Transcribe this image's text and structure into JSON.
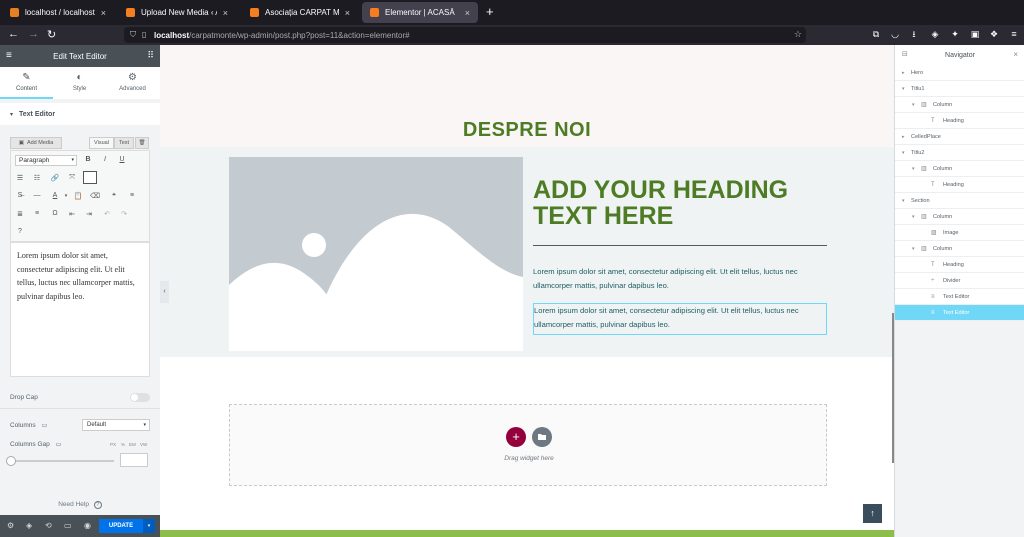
{
  "browser": {
    "tabs": [
      {
        "title": "localhost / localhost | phpMy",
        "color": "#e67e22"
      },
      {
        "title": "Upload New Media ‹ Asociați",
        "color": "#f57f20"
      },
      {
        "title": "Asociația CARPAT MONTE –",
        "color": "#f57f20"
      },
      {
        "title": "Elementor | ACASĂ",
        "color": "#f57f20"
      }
    ],
    "url_host": "localhost",
    "url_path": "/carpatmonte/wp-admin/post.php?post=11&action=elementor#"
  },
  "left_panel": {
    "title": "Edit Text Editor",
    "tabs": [
      {
        "label": "Content",
        "icon": "pencil-icon",
        "glyph": "✎"
      },
      {
        "label": "Style",
        "icon": "half-circle-icon",
        "glyph": "◐"
      },
      {
        "label": "Advanced",
        "icon": "gear-icon",
        "glyph": "⚙"
      }
    ],
    "section": "Text Editor",
    "add_media": "Add Media",
    "visual": "Visual",
    "text": "Text",
    "paragraph_select": "Paragraph",
    "content": "Lorem ipsum dolor sit amet, consectetur adipiscing elit. Ut elit tellus, luctus nec ullamcorper mattis, pulvinar dapibus leo.",
    "drop_cap": "Drop Cap",
    "columns_label": "Columns",
    "columns_value": "Default",
    "columns_gap": "Columns Gap",
    "units": [
      "PX",
      "%",
      "EM",
      "VW"
    ],
    "need_help": "Need Help",
    "update": "UPDATE"
  },
  "canvas": {
    "section_title": "DESPRE NOI",
    "heading": "ADD YOUR HEADING TEXT HERE",
    "paragraph1": "Lorem ipsum dolor sit amet, consectetur adipiscing elit. Ut elit tellus, luctus nec ullamcorper mattis, pulvinar dapibus leo.",
    "paragraph2": "Lorem ipsum dolor sit amet, consectetur adipiscing elit. Ut elit tellus, luctus nec ullamcorper mattis, pulvinar dapibus leo.",
    "drag_text": "Drag widget here"
  },
  "navigator": {
    "title": "Navigator",
    "items": [
      {
        "label": "Hero",
        "level": 0,
        "arrow": "▸",
        "icon": ""
      },
      {
        "label": "Titlu1",
        "level": 0,
        "arrow": "▾",
        "icon": ""
      },
      {
        "label": "Column",
        "level": 1,
        "arrow": "▾",
        "icon": "▥"
      },
      {
        "label": "Heading",
        "level": 2,
        "arrow": "",
        "icon": "T"
      },
      {
        "label": "CelledPlace",
        "level": 0,
        "arrow": "▸",
        "icon": ""
      },
      {
        "label": "Titlu2",
        "level": 0,
        "arrow": "▾",
        "icon": ""
      },
      {
        "label": "Column",
        "level": 1,
        "arrow": "▾",
        "icon": "▥"
      },
      {
        "label": "Heading",
        "level": 2,
        "arrow": "",
        "icon": "T"
      },
      {
        "label": "Section",
        "level": 0,
        "arrow": "▾",
        "icon": ""
      },
      {
        "label": "Column",
        "level": 1,
        "arrow": "▾",
        "icon": "▥"
      },
      {
        "label": "Image",
        "level": 2,
        "arrow": "",
        "icon": "▨"
      },
      {
        "label": "Column",
        "level": 1,
        "arrow": "▾",
        "icon": "▥"
      },
      {
        "label": "Heading",
        "level": 2,
        "arrow": "",
        "icon": "T"
      },
      {
        "label": "Divider",
        "level": 2,
        "arrow": "",
        "icon": "÷"
      },
      {
        "label": "Text Editor",
        "level": 2,
        "arrow": "",
        "icon": "≡"
      },
      {
        "label": "Text Editor",
        "level": 2,
        "arrow": "",
        "icon": "≡",
        "selected": true
      }
    ]
  }
}
